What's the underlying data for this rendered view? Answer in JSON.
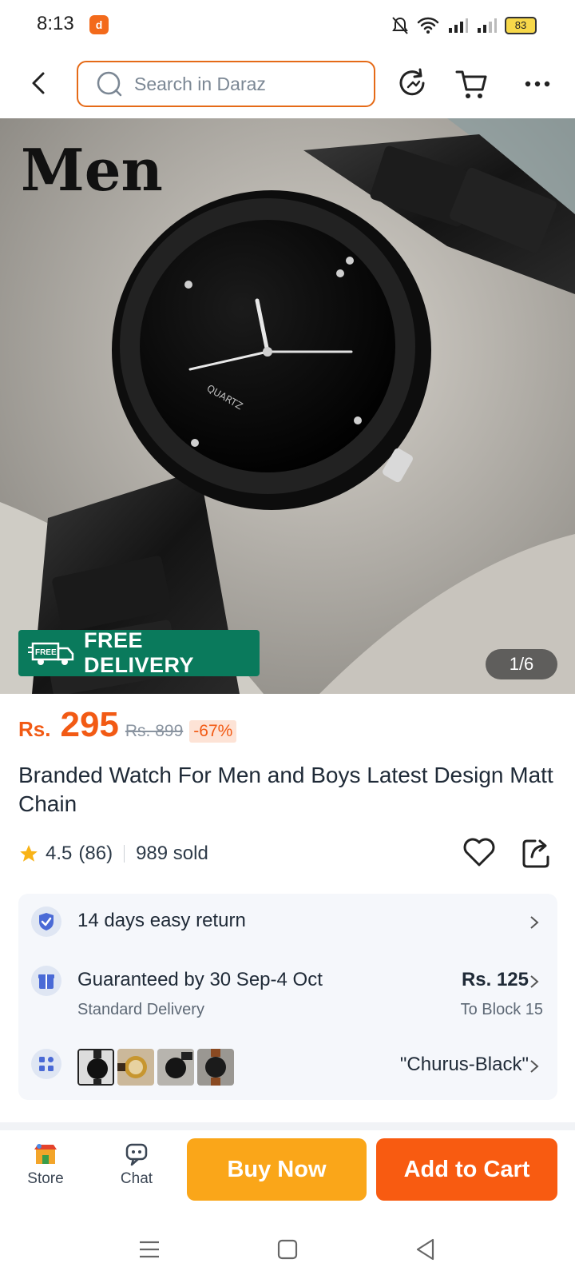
{
  "status_bar": {
    "time": "8:13",
    "app_badge": "d",
    "battery": "83"
  },
  "header": {
    "search_placeholder": "Search in Daraz"
  },
  "hero": {
    "title_text": "Men",
    "free_badge_icon_text": "FREE",
    "free_badge_text": "FREE DELIVERY",
    "page_indicator": "1/6"
  },
  "price": {
    "currency": "Rs.",
    "value": "295",
    "original": "Rs. 899",
    "discount": "-67%"
  },
  "product": {
    "title": "Branded Watch For Men and Boys Latest Design Matt Chain",
    "rating": "4.5",
    "reviews": "(86)",
    "sold": "989 sold"
  },
  "info": {
    "return_text": "14 days easy return",
    "delivery_main": "Guaranteed by 30 Sep-4 Oct",
    "delivery_sub": "Standard Delivery",
    "delivery_price": "Rs. 125",
    "delivery_location": "To Block 15",
    "variant_selected": "\"Churus-Black\""
  },
  "bottom_bar": {
    "store_label": "Store",
    "chat_label": "Chat",
    "buy_now_label": "Buy Now",
    "add_to_cart_label": "Add to Cart"
  },
  "colors": {
    "accent_orange": "#f85b11",
    "buy_now_yellow": "#faa619",
    "delivery_green": "#0a7a5c",
    "price_orange": "#f25a14"
  },
  "icons": [
    "back-arrow-icon",
    "search-icon",
    "refresh-icon",
    "cart-icon",
    "more-icon",
    "heart-icon",
    "share-icon",
    "shield-check-icon",
    "gift-box-icon",
    "grid-icon",
    "store-icon",
    "chat-icon",
    "menu-icon",
    "home-square-icon",
    "back-triangle-icon"
  ]
}
